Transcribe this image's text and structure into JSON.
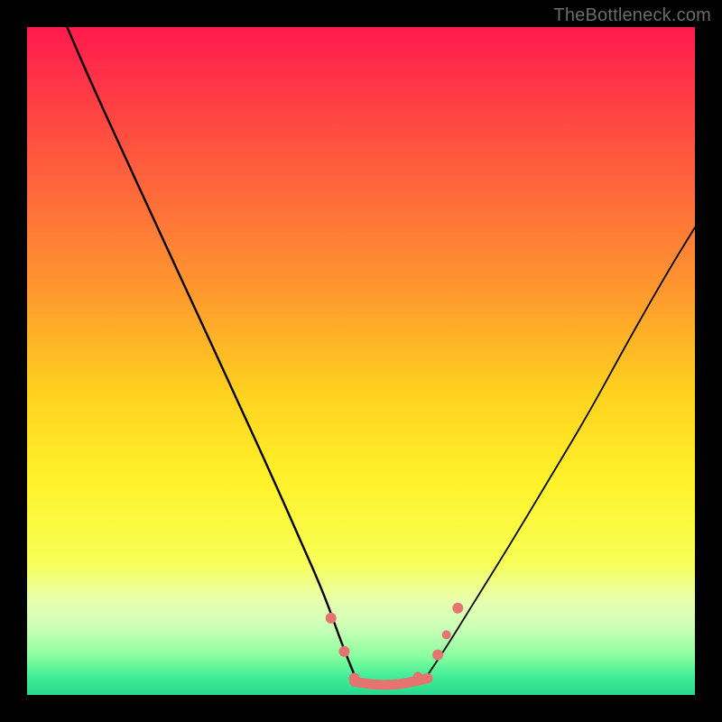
{
  "watermark": "TheBottleneck.com",
  "chart_data": {
    "type": "line",
    "title": "",
    "xlabel": "",
    "ylabel": "",
    "xlim": [
      0,
      100
    ],
    "ylim": [
      0,
      100
    ],
    "background_gradient_stops": [
      {
        "pos": 0.0,
        "color": "#ff1a4d"
      },
      {
        "pos": 0.1,
        "color": "#ff3a45"
      },
      {
        "pos": 0.25,
        "color": "#ff6a3a"
      },
      {
        "pos": 0.4,
        "color": "#ff9a2e"
      },
      {
        "pos": 0.55,
        "color": "#ffd21f"
      },
      {
        "pos": 0.68,
        "color": "#fff22a"
      },
      {
        "pos": 0.8,
        "color": "#f7ff55"
      },
      {
        "pos": 0.86,
        "color": "#e8ffb0"
      },
      {
        "pos": 0.9,
        "color": "#caffb8"
      },
      {
        "pos": 0.94,
        "color": "#8effa0"
      },
      {
        "pos": 0.97,
        "color": "#46ef98"
      },
      {
        "pos": 1.0,
        "color": "#27d98d"
      }
    ],
    "series": [
      {
        "name": "curve-left",
        "stroke": "#000000",
        "stroke_width": 2.4,
        "points": [
          {
            "x": 6.0,
            "y": 100.0
          },
          {
            "x": 9.0,
            "y": 93.0
          },
          {
            "x": 14.0,
            "y": 82.0
          },
          {
            "x": 20.0,
            "y": 69.0
          },
          {
            "x": 26.0,
            "y": 56.0
          },
          {
            "x": 32.0,
            "y": 43.0
          },
          {
            "x": 37.0,
            "y": 32.0
          },
          {
            "x": 41.0,
            "y": 23.0
          },
          {
            "x": 44.5,
            "y": 15.0
          },
          {
            "x": 47.0,
            "y": 8.0
          },
          {
            "x": 49.0,
            "y": 3.0
          }
        ]
      },
      {
        "name": "curve-right",
        "stroke": "#000000",
        "stroke_width": 1.8,
        "points": [
          {
            "x": 60.0,
            "y": 3.0
          },
          {
            "x": 63.0,
            "y": 7.5
          },
          {
            "x": 67.0,
            "y": 14.0
          },
          {
            "x": 72.0,
            "y": 22.0
          },
          {
            "x": 78.0,
            "y": 32.0
          },
          {
            "x": 84.0,
            "y": 42.0
          },
          {
            "x": 90.0,
            "y": 53.0
          },
          {
            "x": 96.0,
            "y": 63.5
          },
          {
            "x": 100.0,
            "y": 70.0
          }
        ]
      },
      {
        "name": "valley-bottom",
        "stroke": "#e5736f",
        "stroke_width": 11,
        "points": [
          {
            "x": 49.0,
            "y": 2.0
          },
          {
            "x": 52.0,
            "y": 1.5
          },
          {
            "x": 55.0,
            "y": 1.5
          },
          {
            "x": 58.0,
            "y": 2.0
          },
          {
            "x": 60.0,
            "y": 2.5
          }
        ]
      }
    ],
    "markers": [
      {
        "x": 45.5,
        "y": 11.5,
        "r": 6,
        "color": "#e5736f"
      },
      {
        "x": 47.5,
        "y": 6.5,
        "r": 6,
        "color": "#e5736f"
      },
      {
        "x": 49.0,
        "y": 2.5,
        "r": 6,
        "color": "#e5736f"
      },
      {
        "x": 58.5,
        "y": 2.8,
        "r": 5,
        "color": "#e5736f"
      },
      {
        "x": 61.5,
        "y": 6.0,
        "r": 6,
        "color": "#e5736f"
      },
      {
        "x": 62.8,
        "y": 9.0,
        "r": 5,
        "color": "#e5736f"
      },
      {
        "x": 64.5,
        "y": 13.0,
        "r": 6,
        "color": "#e5736f"
      }
    ]
  }
}
